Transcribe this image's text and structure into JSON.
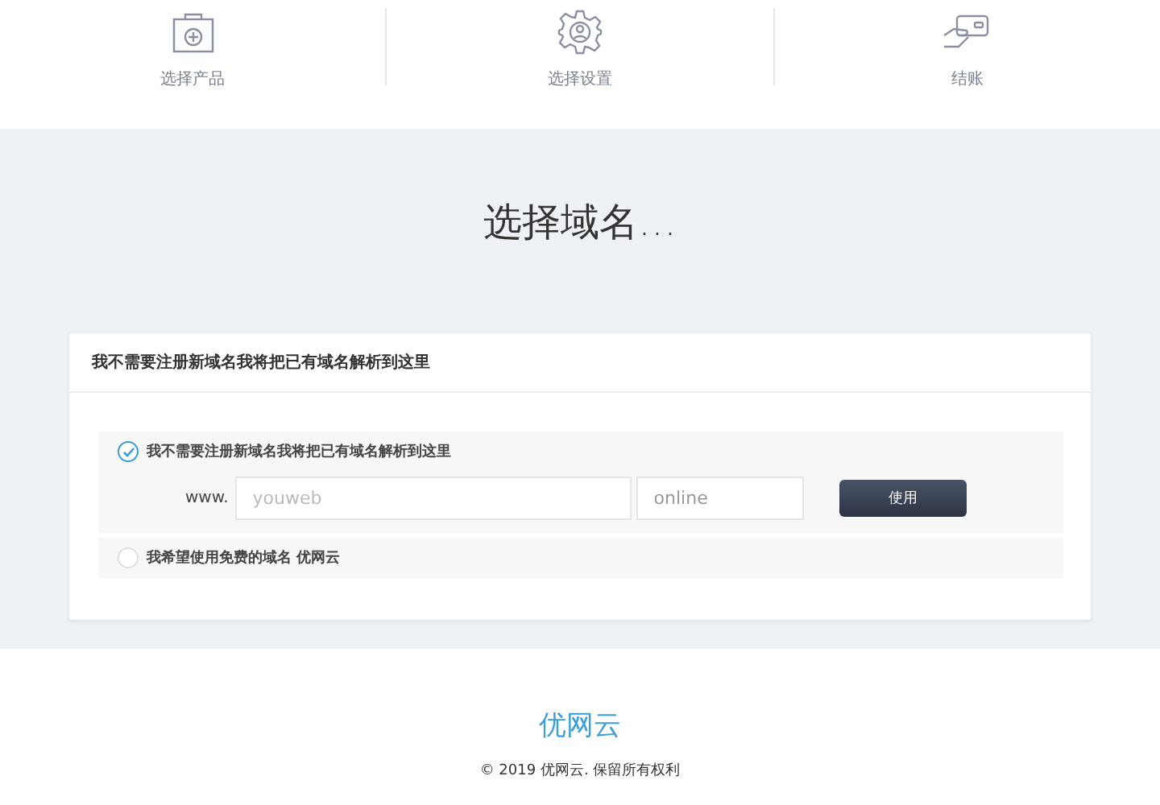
{
  "steps": [
    {
      "label": "选择产品"
    },
    {
      "label": "选择设置"
    },
    {
      "label": "结账"
    }
  ],
  "heading": "选择域名…",
  "card": {
    "title": "我不需要注册新域名我将把已有域名解析到这里",
    "options": [
      {
        "label": "我不需要注册新域名我将把已有域名解析到这里",
        "selected": true,
        "form": {
          "prefix": "www.",
          "name_placeholder": "youweb",
          "tld_value": "online",
          "button": "使用"
        }
      },
      {
        "label": "我希望使用免费的域名 优网云",
        "selected": false
      }
    ]
  },
  "footer": {
    "brand": "优网云",
    "copyright": "© 2019 优网云. 保留所有权利"
  }
}
